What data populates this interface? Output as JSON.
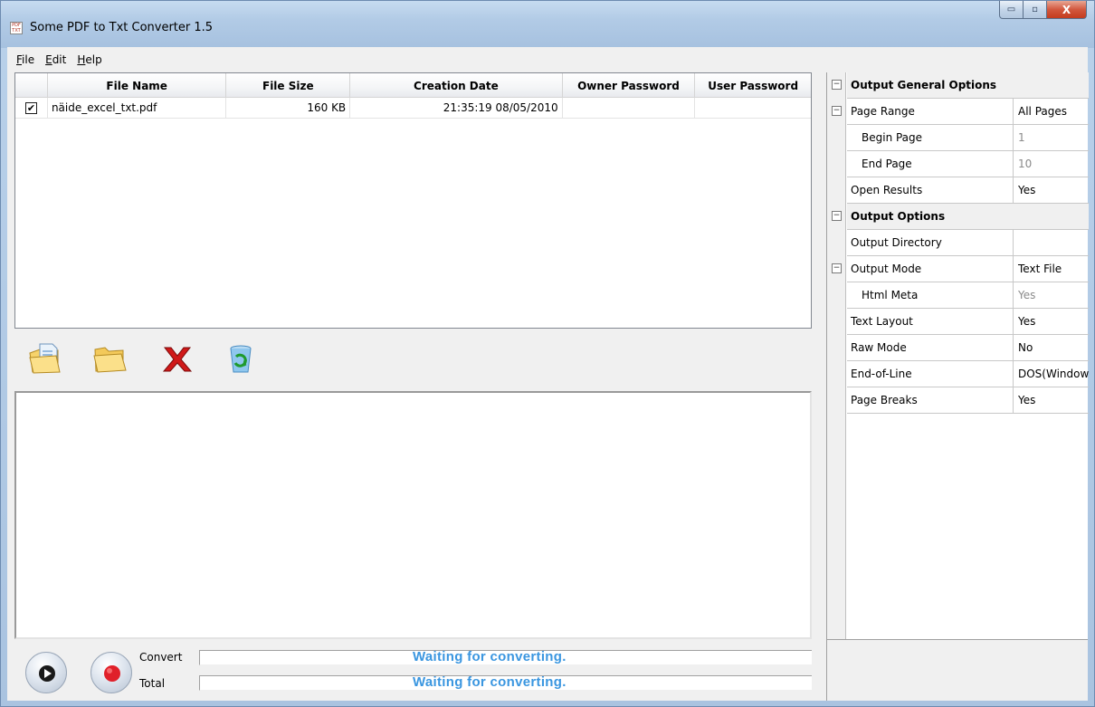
{
  "window": {
    "title": "Some PDF to Txt Converter 1.5",
    "icon_text": "PDF TXT",
    "controls": {
      "minimize": "▭",
      "maximize": "▫",
      "close": "X"
    }
  },
  "menu": [
    {
      "label": "File",
      "accel": "F"
    },
    {
      "label": "Edit",
      "accel": "E"
    },
    {
      "label": "Help",
      "accel": "H"
    }
  ],
  "filelist": {
    "columns": [
      "",
      "File Name",
      "File Size",
      "Creation Date",
      "Owner Password",
      "User Password"
    ],
    "rows": [
      {
        "checked": "✔",
        "name": "näide_excel_txt.pdf",
        "size": "160 KB",
        "date": "21:35:19 08/05/2010",
        "owner": "",
        "user": ""
      }
    ]
  },
  "toolbar": {
    "icons": [
      "add-file-icon",
      "open-folder-icon",
      "delete-icon",
      "recycle-icon"
    ]
  },
  "progress": {
    "convert_label": "Convert",
    "total_label": "Total",
    "convert_status": "Waiting for converting.",
    "total_status": "Waiting for converting."
  },
  "properties": {
    "general": {
      "title": "Output General Options",
      "page_range": {
        "name": "Page Range",
        "value": "All Pages"
      },
      "begin_page": {
        "name": "Begin Page",
        "value": "1"
      },
      "end_page": {
        "name": "End Page",
        "value": "10"
      },
      "open_results": {
        "name": "Open Results",
        "value": "Yes"
      }
    },
    "output": {
      "title": "Output Options",
      "output_directory": {
        "name": "Output Directory",
        "value": ""
      },
      "output_mode": {
        "name": "Output Mode",
        "value": "Text File"
      },
      "html_meta": {
        "name": "Html Meta",
        "value": "Yes"
      },
      "text_layout": {
        "name": "Text Layout",
        "value": "Yes"
      },
      "raw_mode": {
        "name": "Raw Mode",
        "value": "No"
      },
      "end_of_line": {
        "name": "End-of-Line",
        "value": "DOS(Windows)"
      },
      "page_breaks": {
        "name": "Page Breaks",
        "value": "Yes"
      }
    }
  },
  "colors": {
    "status_text": "#3a96e0",
    "title_bar": "#b2cbe6",
    "close_button": "#c43b1e"
  }
}
